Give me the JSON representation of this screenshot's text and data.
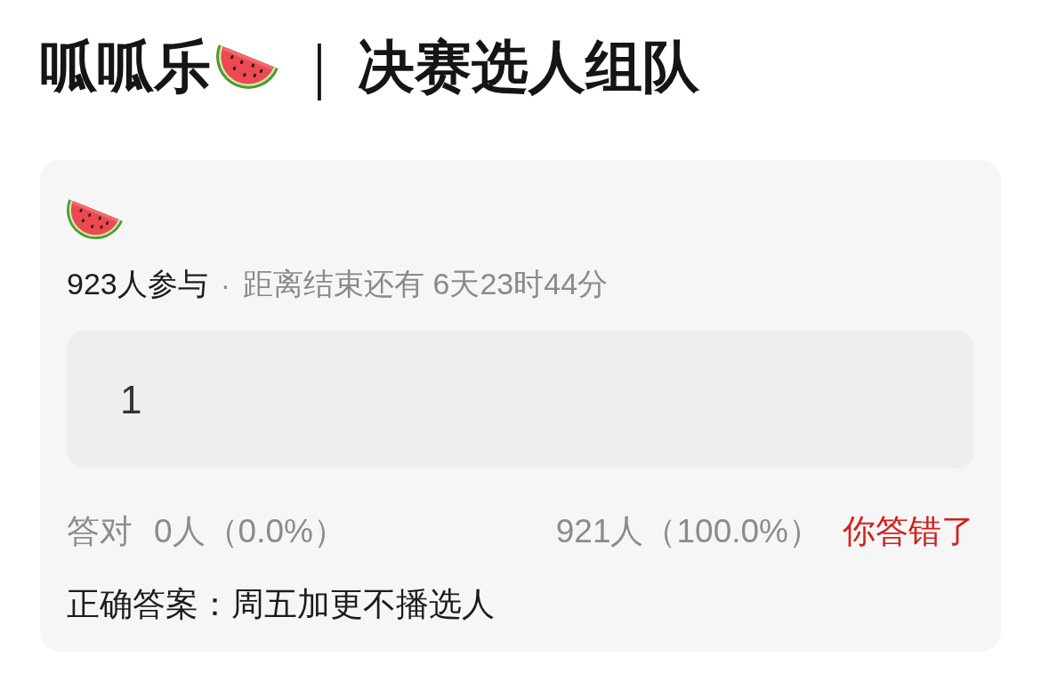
{
  "header": {
    "title": "呱呱乐",
    "separator": "｜",
    "subtitle": "决赛选人组队"
  },
  "quiz": {
    "participants": "923人参与",
    "dot": "·",
    "countdown": "距离结束还有 6天23时44分",
    "answer": "1",
    "stats": {
      "correct_label": "答对",
      "correct_count": "0人（0.0%）",
      "answer_count": "921人（100.0%）",
      "result": "你答错了",
      "result_correct": false
    },
    "correct_answer": "正确答案：周五加更不播选人"
  }
}
